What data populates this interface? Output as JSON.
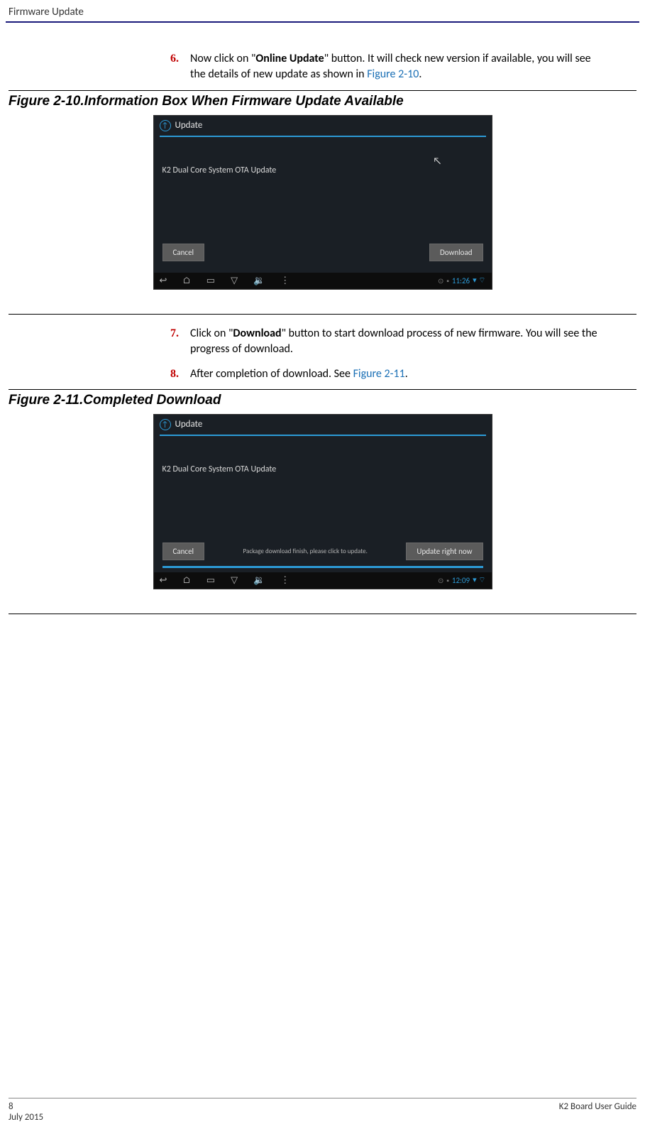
{
  "header": {
    "title": "Firmware Update"
  },
  "steps": {
    "s6": {
      "num": "6.",
      "text_pre": "Now click on \"",
      "text_bold": "Online Update",
      "text_post": "\" button. It will check new version if available, you will see the details of new update as shown in ",
      "link": "Figure 2-10",
      "text_end": "."
    },
    "s7": {
      "num": "7.",
      "text_pre": "Click on \"",
      "text_bold": "Download",
      "text_post": "\" button to start download process of new firmware. You will see the progress of download."
    },
    "s8": {
      "num": "8.",
      "text_pre": "After completion of download. See ",
      "link": "Figure 2-11",
      "text_end": "."
    }
  },
  "figures": {
    "f10": {
      "caption": "Figure 2-10.Information Box When Firmware Update Available"
    },
    "f11": {
      "caption": "Figure 2-11.Completed Download"
    }
  },
  "screenshot1": {
    "header_title": "Update",
    "body_text": "K2 Dual Core System OTA Update",
    "btn_cancel": "Cancel",
    "btn_action": "Download",
    "time": "11:26",
    "wifi_bt": "▾ ⌔"
  },
  "screenshot2": {
    "header_title": "Update",
    "body_text": "K2 Dual Core System OTA Update",
    "status_text": "Package download finish, please click to update.",
    "btn_cancel": "Cancel",
    "btn_action": "Update right now",
    "time": "12:09",
    "wifi_bt": "▾ ⌔"
  },
  "nav_icons": {
    "back": "↩",
    "home": "⌂",
    "recent": "▭",
    "down": "▽",
    "vol": "🔉",
    "more": "⋮",
    "clock": "⊙",
    "dl": "▪"
  },
  "footer": {
    "page": "8",
    "date": "July 2015",
    "guide": "K2 Board User Guide"
  }
}
